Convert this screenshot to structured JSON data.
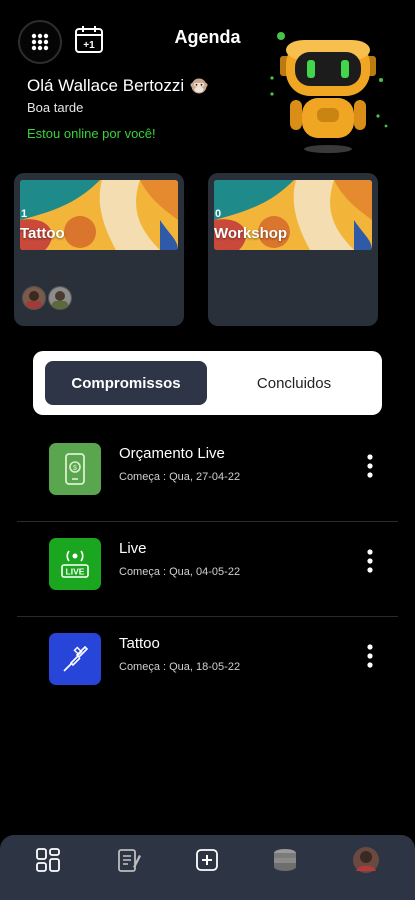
{
  "header": {
    "title": "Agenda",
    "menu_icon": "grid-dots-icon",
    "calendar_icon": "calendar-plus-one-icon",
    "calendar_badge": "+1",
    "greeting": "Olá Wallace Bertozzi",
    "greeting_icon": "monkey-emoji-icon",
    "subgreeting": "Boa tarde",
    "online_status": "Estou online por você!",
    "online_color": "#39d23b"
  },
  "categories": [
    {
      "count": "1",
      "label": "Tattoo"
    },
    {
      "count": "0",
      "label": "Workshop"
    }
  ],
  "tabs": {
    "active": "Compromissos",
    "inactive": "Concluidos"
  },
  "appointments": [
    {
      "title": "Orçamento Live",
      "date": "Começa : Qua, 27-04-22",
      "icon": "phone-dollar-icon",
      "color": "#5aa64f"
    },
    {
      "title": "Live",
      "date": "Começa : Qua, 04-05-22",
      "icon": "live-broadcast-icon",
      "color": "#1aa61e"
    },
    {
      "title": "Tattoo",
      "date": "Começa : Qua, 18-05-22",
      "icon": "tattoo-machine-icon",
      "color": "#2745d9"
    }
  ],
  "bottom_nav": [
    "dashboard-icon",
    "notes-icon",
    "add-icon",
    "coins-icon",
    "profile-avatar"
  ]
}
